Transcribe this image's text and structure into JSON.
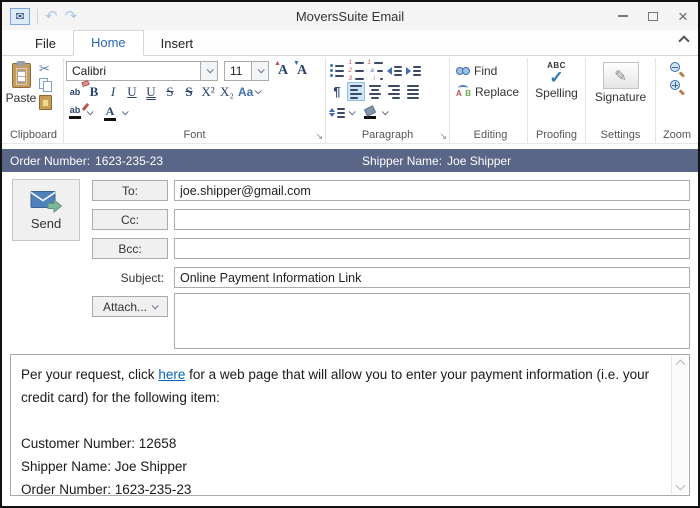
{
  "window": {
    "title": "MoversSuite Email"
  },
  "tabs": {
    "file": "File",
    "home": "Home",
    "insert": "Insert"
  },
  "ribbon": {
    "clipboard": {
      "label": "Clipboard",
      "paste": "Paste"
    },
    "font": {
      "label": "Font",
      "family": "Calibri",
      "size": "11",
      "buttons": [
        "B",
        "I",
        "U",
        "U",
        "S",
        "S",
        "X²",
        "X₂",
        "Aa",
        "A",
        "A"
      ]
    },
    "paragraph": {
      "label": "Paragraph",
      "pilcrow": "¶"
    },
    "editing": {
      "label": "Editing",
      "find": "Find",
      "replace": "Replace"
    },
    "proofing": {
      "label": "Proofing",
      "spelling": "Spelling",
      "abc": "ABC",
      "check": "✓"
    },
    "settings": {
      "label": "Settings",
      "signature": "Signature",
      "pen": "✎"
    },
    "zoom": {
      "label": "Zoom"
    }
  },
  "quick_access": {
    "mail_glyph": "✉",
    "undo_glyph": "↶",
    "redo_glyph": "↷"
  },
  "window_controls": {
    "close_glyph": "×"
  },
  "launcher_glyph": "↘",
  "clipboard_icons": {
    "cut_glyph": "✂"
  },
  "info_bar": {
    "order_label": "Order Number:",
    "order_value": "1623-235-23",
    "shipper_label": "Shipper Name:",
    "shipper_value": "Joe Shipper"
  },
  "compose": {
    "send": "Send",
    "to_label": "To:",
    "to_value": "joe.shipper@gmail.com",
    "cc_label": "Cc:",
    "cc_value": "",
    "bcc_label": "Bcc:",
    "bcc_value": "",
    "subject_label": "Subject:",
    "subject_value": "Online Payment Information Link",
    "attach_label": "Attach..."
  },
  "body": {
    "para_before_link": "Per your request, click ",
    "link": "here",
    "para_after_link": " for a web page that will allow you to enter your payment information (i.e. your credit card) for the following item:",
    "lines": [
      "Customer Number: 12658",
      "Shipper Name: Joe Shipper",
      "Order Number: 1623-235-23"
    ]
  },
  "colors": {
    "info_bar": "#5a6687",
    "active_tab": "#2b6cb8",
    "link": "#0563c1",
    "selection": "#cde6f7"
  }
}
